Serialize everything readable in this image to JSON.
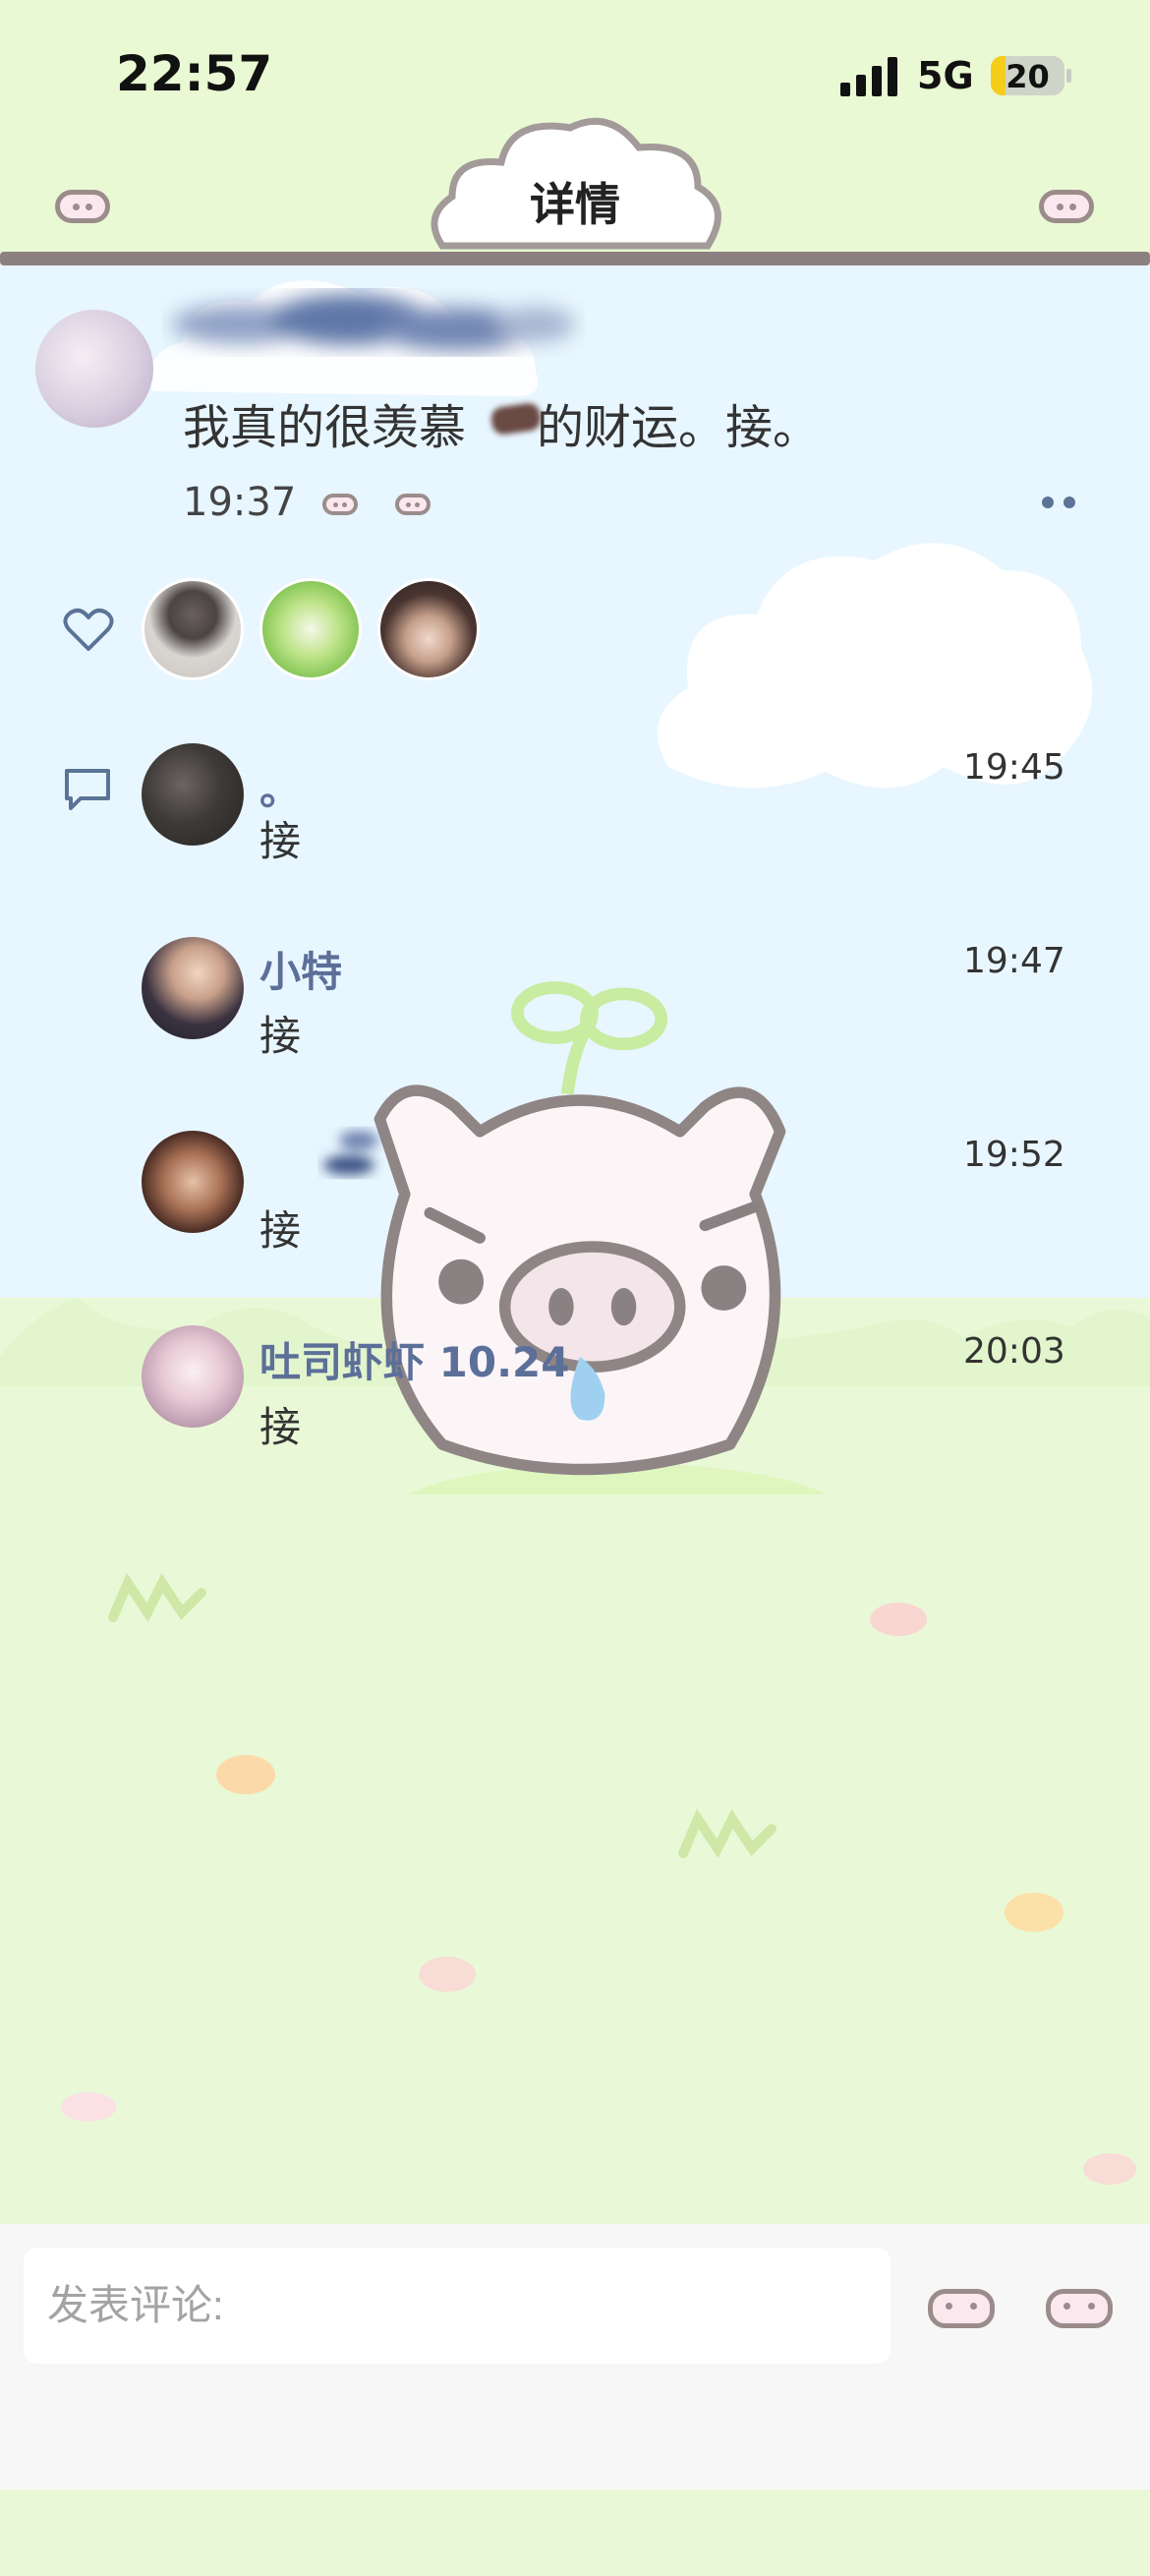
{
  "status_bar": {
    "time": "22:57",
    "network": "5G",
    "battery": "20",
    "battery_level": 0.2
  },
  "header": {
    "title": "详情"
  },
  "post": {
    "text_before": "我真的很羡慕",
    "text_after": "的财运。接。",
    "time": "19:37"
  },
  "likes": {
    "icon": "heart-icon",
    "avatars": [
      "liker-1",
      "liker-2",
      "liker-3"
    ]
  },
  "comments": [
    {
      "name": "。",
      "text": "接",
      "time": "19:45"
    },
    {
      "name": "小特",
      "text": "接",
      "time": "19:47"
    },
    {
      "name": "",
      "text": "接",
      "time": "19:52"
    },
    {
      "name": "吐司虾虾 10.24",
      "text": "接",
      "time": "20:03"
    }
  ],
  "bottom_bar": {
    "placeholder": "发表评论:"
  },
  "colors": {
    "accent": "#5c6f99",
    "sky": "#e8f6ff",
    "grass": "#e9f9d7"
  }
}
